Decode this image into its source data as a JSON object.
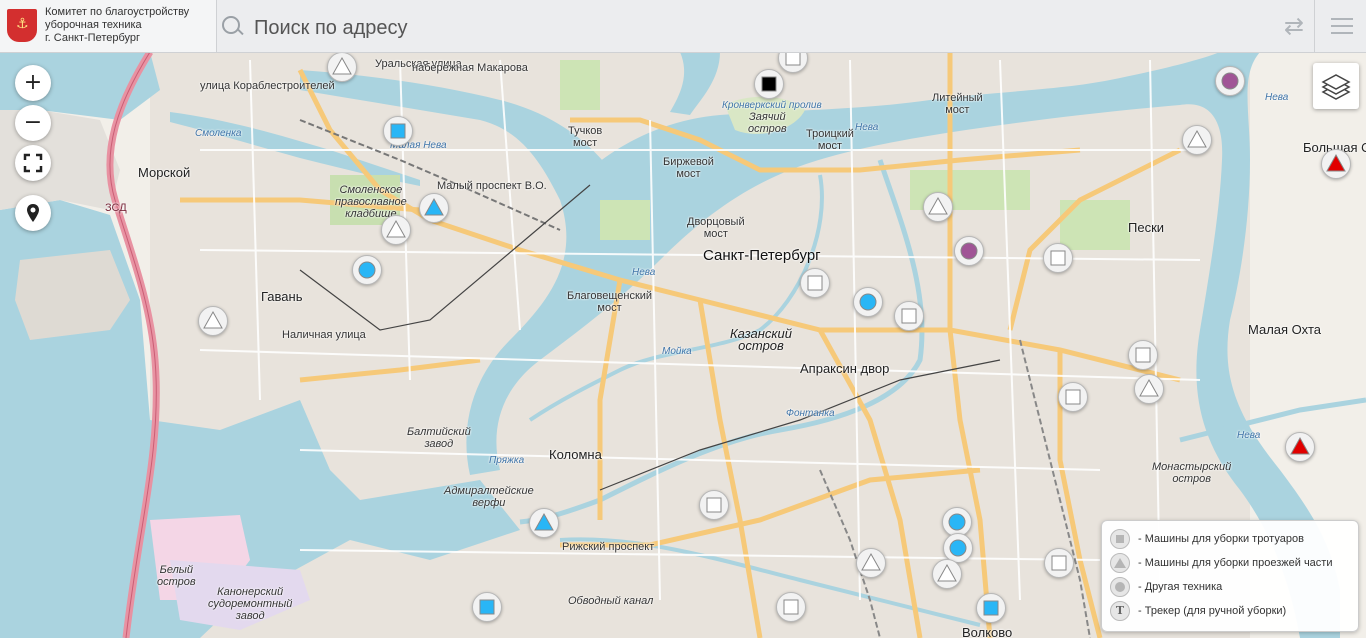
{
  "header": {
    "org_lines": [
      "Комитет по благоустройству",
      "уборочная техника",
      "г. Санкт-Петербург"
    ],
    "search_placeholder": "Поиск по адресу",
    "icons": [
      "coat-of-arms-icon",
      "search-icon",
      "swap-arrows-icon",
      "hamburger-menu-icon"
    ]
  },
  "map_controls": {
    "zoom_in": "+",
    "zoom_out": "−",
    "icons": [
      "fullscreen-icon",
      "locate-pin-icon",
      "layers-icon"
    ]
  },
  "colors": {
    "water": "#aad3df",
    "land": "#f2efe9",
    "major_road": "#f6c979",
    "ring_road": "#e892a2",
    "marker_blue": "#29b6f6",
    "marker_red": "#e10000",
    "marker_purple": "#a05596",
    "marker_black": "#000000"
  },
  "map_labels": {
    "city": "Санкт-Петербург",
    "morskoy": "Морской",
    "gavan": "Гавань",
    "kolomna": "Коломна",
    "peski": "Пески",
    "malaya_okhta": "Малая Охта",
    "apraksin": "Апраксин двор",
    "bolshaya_o": "Большая О",
    "kazansky_1": "Казанский",
    "kazansky_2": "остров",
    "zayachiy_1": "Заячий",
    "zayachiy_2": "остров",
    "monastyrsky_1": "Монастырский",
    "monastyrsky_2": "остров",
    "tuchkov_1": "Тучков",
    "tuchkov_2": "мост",
    "birzhevoy_1": "Биржевой",
    "birzhevoy_2": "мост",
    "dvortsovy_1": "Дворцовый",
    "dvortsovy_2": "мост",
    "troitsky_1": "Троицкий",
    "troitsky_2": "мост",
    "liteyny_1": "Литейный",
    "liteyny_2": "мост",
    "blagov_1": "Благовещенский",
    "blagov_2": "мост",
    "cemetery_1": "Смоленское",
    "cemetery_2": "православное",
    "cemetery_3": "кладбище",
    "baltic_1": "Балтийский",
    "baltic_2": "завод",
    "admiralty_1": "Адмиралтейские",
    "admiralty_2": "верфи",
    "beliy_1": "Белый",
    "beliy_2": "остров",
    "kanoner_1": "Канонерский",
    "kanoner_2": "судоремонтный",
    "kanoner_3": "завод",
    "volkovo": "Волково",
    "neva": "Нева",
    "malaya_neva": "Малая Нева",
    "moyka": "Мойка",
    "fontanka": "Фонтанка",
    "pryazhka": "Пряжка",
    "smolenka": "Смоленка",
    "kronverksky": "Кронверкский пролив",
    "zsd": "ЗСД",
    "rizhsky": "Рижский проспект",
    "obvodny": "Обводный канал",
    "nalichnaya": "Наличная улица",
    "uralskaya": "Уральская улица",
    "makarova": "набережная Макарова",
    "vo_street": "Малый проспект В.О.",
    "korablestroiteley": "улица Кораблестроителей"
  },
  "legend": {
    "items": [
      {
        "icon": "gray-square-icon",
        "label": "- Машины для уборки тротуаров"
      },
      {
        "icon": "gray-triangle-icon",
        "label": "- Машины для уборки проезжей части"
      },
      {
        "icon": "gray-circle-icon",
        "label": "- Другая техника"
      },
      {
        "icon": "tracker-t-icon",
        "label": "- Трекер (для ручной уборки)"
      }
    ]
  },
  "markers": [
    {
      "id": "m1",
      "shape": "triangle",
      "color": "#ffffff"
    },
    {
      "id": "m2",
      "shape": "square",
      "color": "#29b6f6"
    },
    {
      "id": "m3",
      "shape": "triangle",
      "color": "#29b6f6"
    },
    {
      "id": "m4",
      "shape": "triangle",
      "color": "#ffffff"
    },
    {
      "id": "m5",
      "shape": "circle",
      "color": "#29b6f6"
    },
    {
      "id": "m6",
      "shape": "triangle",
      "color": "#ffffff"
    },
    {
      "id": "m7",
      "shape": "square",
      "color": "#000000"
    },
    {
      "id": "m8",
      "shape": "square",
      "color": "#ffffff"
    },
    {
      "id": "m9",
      "shape": "triangle",
      "color": "#ffffff"
    },
    {
      "id": "m10",
      "shape": "circle",
      "color": "#a05596"
    },
    {
      "id": "m11",
      "shape": "square",
      "color": "#ffffff"
    },
    {
      "id": "m12",
      "shape": "square",
      "color": "#ffffff"
    },
    {
      "id": "m13",
      "shape": "circle",
      "color": "#29b6f6"
    },
    {
      "id": "m14",
      "shape": "square",
      "color": "#ffffff"
    },
    {
      "id": "m15",
      "shape": "square",
      "color": "#ffffff"
    },
    {
      "id": "m16",
      "shape": "triangle",
      "color": "#ffffff"
    },
    {
      "id": "m17",
      "shape": "square",
      "color": "#ffffff"
    },
    {
      "id": "m18",
      "shape": "triangle",
      "color": "#ffffff"
    },
    {
      "id": "m19",
      "shape": "circle",
      "color": "#a05596"
    },
    {
      "id": "m20",
      "shape": "triangle",
      "color": "#e10000"
    },
    {
      "id": "m21",
      "shape": "triangle",
      "color": "#e10000"
    },
    {
      "id": "m22",
      "shape": "triangle",
      "color": "#29b6f6"
    },
    {
      "id": "m23",
      "shape": "square",
      "color": "#ffffff"
    },
    {
      "id": "m24",
      "shape": "triangle",
      "color": "#ffffff"
    },
    {
      "id": "m25",
      "shape": "circle",
      "color": "#29b6f6"
    },
    {
      "id": "m26",
      "shape": "circle",
      "color": "#29b6f6"
    },
    {
      "id": "m27",
      "shape": "triangle",
      "color": "#ffffff"
    },
    {
      "id": "m28",
      "shape": "square",
      "color": "#29b6f6"
    },
    {
      "id": "m29",
      "shape": "square",
      "color": "#ffffff"
    },
    {
      "id": "m30",
      "shape": "square",
      "color": "#29b6f6"
    },
    {
      "id": "m31",
      "shape": "square",
      "color": "#ffffff"
    }
  ]
}
